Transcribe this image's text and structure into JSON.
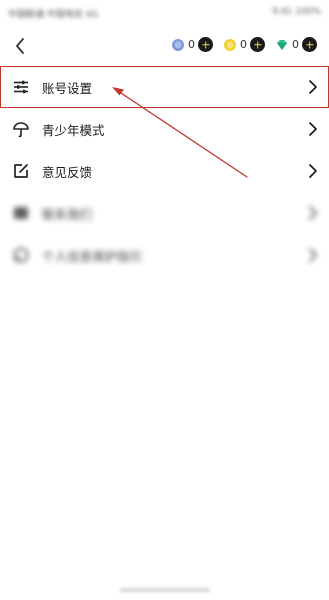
{
  "status_bar": {
    "left_text": "中国联通 中国电信 4G",
    "right_text": "9:41 100%"
  },
  "header": {
    "back_icon": "chevron-left-icon",
    "counters": [
      {
        "icon": "blue-coin-icon",
        "value": "0",
        "color": "#7f9ad8"
      },
      {
        "icon": "gold-coin-icon",
        "value": "0",
        "color": "#f2d22e"
      },
      {
        "icon": "green-diamond-icon",
        "value": "0",
        "color": "#27c08a"
      }
    ]
  },
  "menu": {
    "items": [
      {
        "label": "账号设置",
        "icon": "sliders-icon",
        "highlighted": true
      },
      {
        "label": "青少年模式",
        "icon": "umbrella-icon"
      },
      {
        "label": "意见反馈",
        "icon": "edit-feedback-icon"
      },
      {
        "label": "联系我们",
        "icon": "contact-icon",
        "blurred": true
      },
      {
        "label": "个人信息保护指引",
        "icon": "privacy-icon",
        "blurred": true
      }
    ]
  },
  "colors": {
    "highlight_border": "#c0392b",
    "annotation_arrow": "#c0392b"
  }
}
